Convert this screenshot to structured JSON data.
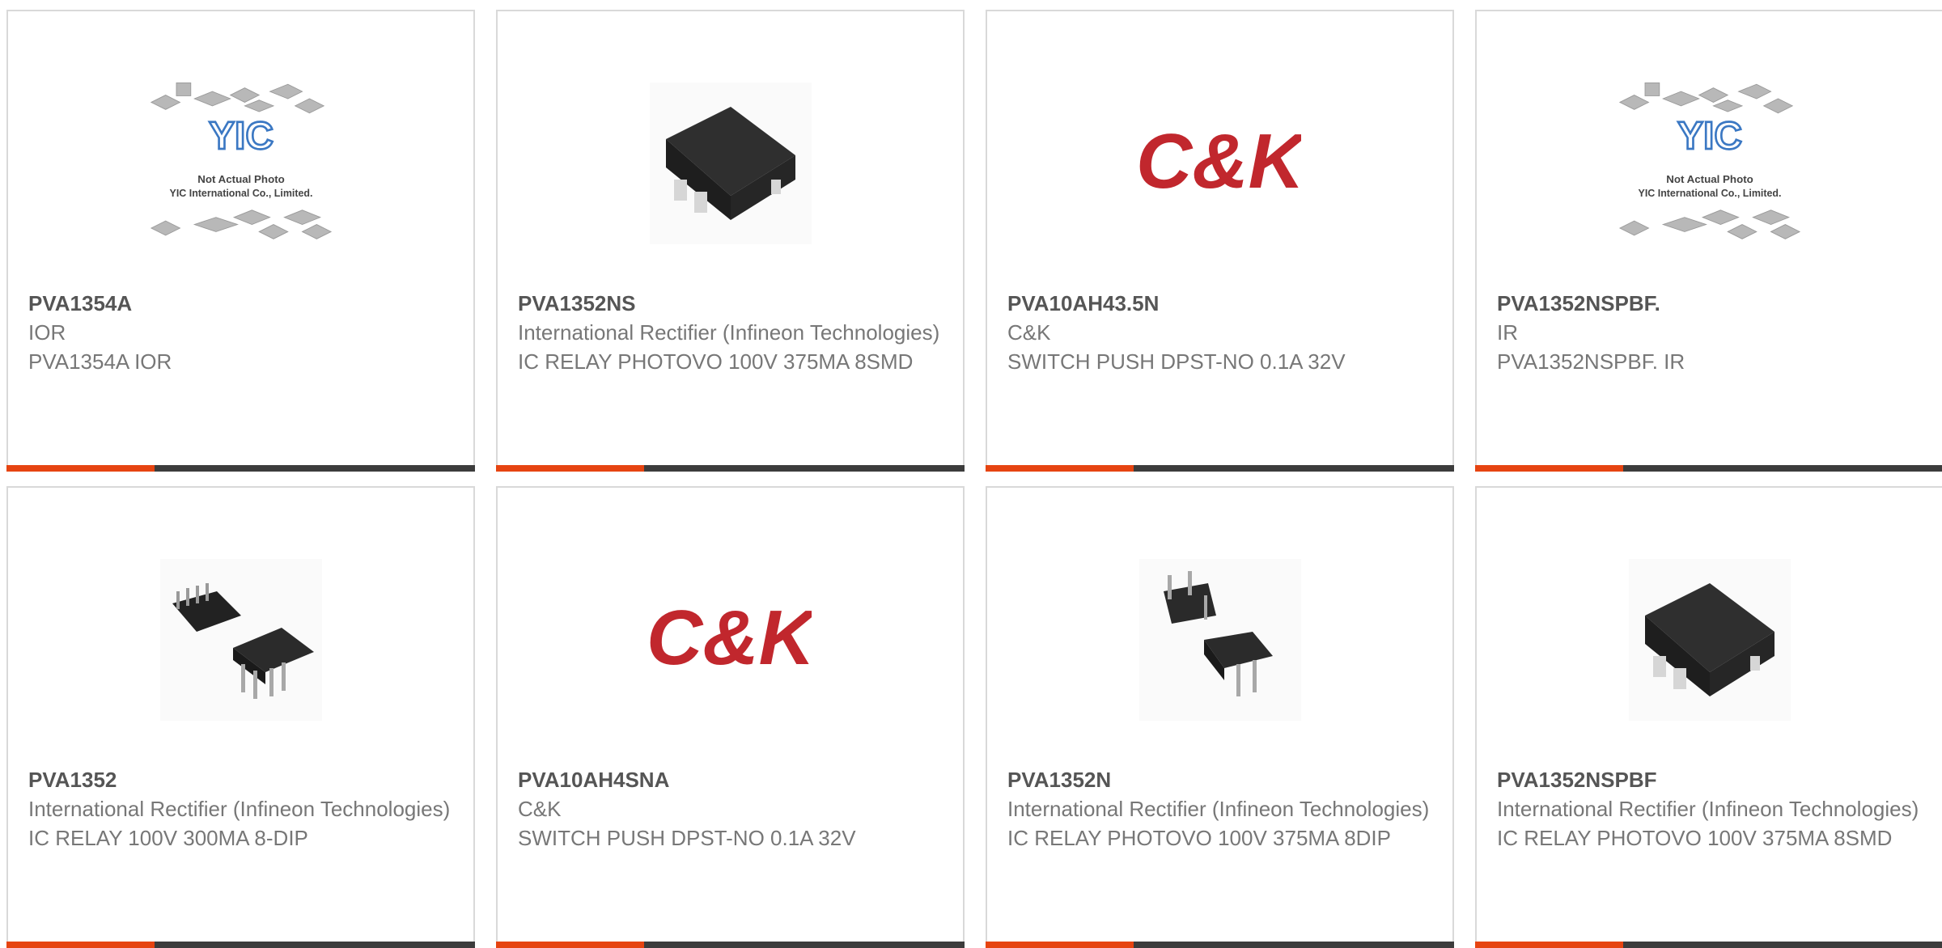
{
  "colors": {
    "accent": "#e64411",
    "bar": "#3c3c3c",
    "part_number": "#555555",
    "text": "#777777"
  },
  "products": [
    {
      "part_number": "PVA1354A",
      "manufacturer": "IOR",
      "description": "PVA1354A IOR",
      "image": "yic-placeholder",
      "image_text": {
        "line1": "Not Actual Photo",
        "line2": "YIC International Co., Limited."
      }
    },
    {
      "part_number": "PVA1352NS",
      "manufacturer": "International Rectifier (Infineon Technologies)",
      "description": "IC RELAY PHOTOVO 100V 375MA 8SMD",
      "image": "smd-package-photo"
    },
    {
      "part_number": "PVA10AH43.5N",
      "manufacturer": "C&K",
      "description": "SWITCH PUSH DPST-NO 0.1A 32V",
      "image": "ck-logo",
      "logo_text": "C&K"
    },
    {
      "part_number": "PVA1352NSPBF.",
      "manufacturer": "IR",
      "description": "PVA1352NSPBF. IR",
      "image": "yic-placeholder",
      "image_text": {
        "line1": "Not Actual Photo",
        "line2": "YIC International Co., Limited."
      }
    },
    {
      "part_number": "PVA1352",
      "manufacturer": "International Rectifier (Infineon Technologies)",
      "description": "IC RELAY 100V 300MA 8-DIP",
      "image": "dip-package-photo"
    },
    {
      "part_number": "PVA10AH4SNA",
      "manufacturer": "C&K",
      "description": "SWITCH PUSH DPST-NO 0.1A 32V",
      "image": "ck-logo",
      "logo_text": "C&K"
    },
    {
      "part_number": "PVA1352N",
      "manufacturer": "International Rectifier (Infineon Technologies)",
      "description": "IC RELAY PHOTOVO 100V 375MA 8DIP",
      "image": "dip-package-photo"
    },
    {
      "part_number": "PVA1352NSPBF",
      "manufacturer": "International Rectifier (Infineon Technologies)",
      "description": "IC RELAY PHOTOVO 100V 375MA 8SMD",
      "image": "smd-package-photo"
    }
  ]
}
